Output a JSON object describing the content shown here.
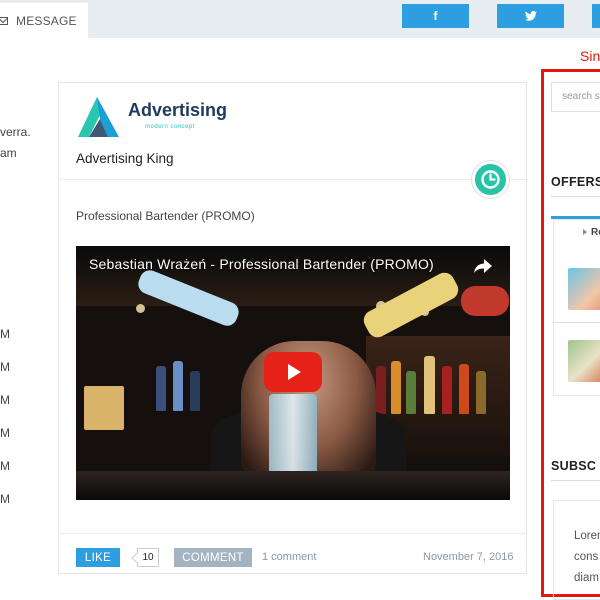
{
  "topbar": {
    "message_tab": {
      "label": "MESSAGE",
      "icon": "envelope-icon"
    },
    "share_buttons": [
      {
        "icon": "facebook-icon",
        "glyph": "f"
      },
      {
        "icon": "twitter-icon",
        "glyph": "🐦"
      }
    ]
  },
  "left_column": {
    "fragments": [
      "verra.",
      "am"
    ],
    "list_fragments": [
      "M",
      "M",
      "M",
      "M",
      "M",
      "M"
    ]
  },
  "post": {
    "brand_name": "Advertising",
    "brand_tagline": "modern concept",
    "author": "Advertising King",
    "clock_icon": "clock-icon",
    "description": "Professional Bartender (PROMO)",
    "video": {
      "title": "Sebastian Wrażeń - Professional Bartender (PROMO)",
      "play_icon": "play-icon",
      "share_icon": "share-arrow-icon"
    },
    "like_label": "LIKE",
    "like_count": "10",
    "comment_label": "COMMENT",
    "comment_count": "1 comment",
    "date": "November 7, 2016"
  },
  "sidebar": {
    "sign_text": "Sin",
    "search_placeholder": "search s",
    "offers_heading": "OFFERS",
    "offers_label": "Re",
    "subscribe_heading": "SUBSC",
    "subscribe_lines": [
      "Lorem",
      "cons",
      "diam"
    ],
    "highlight_color": "#e4170f"
  },
  "colors": {
    "accent": "#2d9ee0",
    "teal": "#27c4a7",
    "youtube_red": "#e62117",
    "comment_gray": "#a4b3c1"
  }
}
